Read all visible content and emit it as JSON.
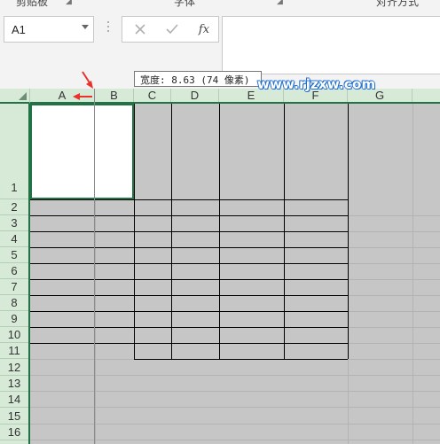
{
  "ribbon": {
    "groups": [
      "剪贴板",
      "字体",
      "对齐方式"
    ]
  },
  "name_box": {
    "value": "A1"
  },
  "formula_bar": {
    "cancel_icon": "cancel-x-icon",
    "enter_icon": "checkmark-icon",
    "function_label": "fx",
    "value": ""
  },
  "tooltip": {
    "text": "宽度: 8.63 (74 像素)"
  },
  "watermark": {
    "text": "www.rjzxw.com"
  },
  "columns": [
    "A",
    "B",
    "C",
    "D",
    "E",
    "F",
    "G"
  ],
  "rows": [
    "1",
    "2",
    "3",
    "4",
    "5",
    "6",
    "7",
    "8",
    "9",
    "10",
    "11",
    "12",
    "13",
    "14",
    "15",
    "16"
  ],
  "colors": {
    "header_bg": "#d7ead8",
    "accent": "#217346",
    "cell_gray": "#c6c6c6",
    "arrow_red": "#e8332a",
    "watermark_blue": "#1e6fd0"
  }
}
